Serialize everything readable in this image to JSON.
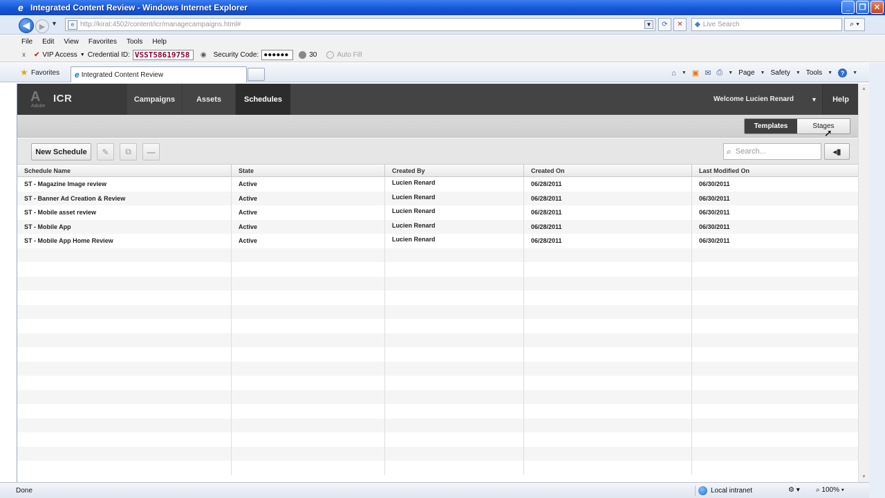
{
  "browser": {
    "window_title": "Integrated Content Review - Windows Internet Explorer",
    "address_url": "http://kirat:4502/content/icr/managecampaigns.html#",
    "search_placeholder": "Live Search",
    "menu": [
      "File",
      "Edit",
      "View",
      "Favorites",
      "Tools",
      "Help"
    ],
    "vip_toolbar": {
      "close_glyph": "x",
      "vip_label": "VIP Access",
      "credential_label": "Credential ID:",
      "credential_value": "VSST58619758",
      "security_label": "Security Code:",
      "security_value": "●●●●●●",
      "timer_value": "30",
      "autofill_label": "Auto Fill"
    },
    "favorites_label": "Favorites",
    "tab_title": "Integrated Content Review",
    "commands": {
      "page": "Page",
      "safety": "Safety",
      "tools": "Tools"
    },
    "status": {
      "left": "Done",
      "zone": "Local intranet",
      "zoom": "100%"
    }
  },
  "app": {
    "logo_word": "Adobe",
    "product": "ICR",
    "nav_tabs": [
      {
        "label": "Campaigns",
        "active": false
      },
      {
        "label": "Assets",
        "active": false
      },
      {
        "label": "Schedules",
        "active": true
      }
    ],
    "welcome": "Welcome Lucien Renard",
    "help": "Help",
    "segment": {
      "templates": "Templates",
      "stages": "Stages"
    },
    "new_schedule": "New Schedule",
    "search_placeholder": "Search...",
    "table": {
      "columns": [
        "Schedule Name",
        "State",
        "Created By",
        "Created On",
        "Last Modified On"
      ],
      "rows": [
        [
          "ST - Magazine Image review",
          "Active",
          "Lucien Renard",
          "06/28/2011",
          "06/30/2011"
        ],
        [
          "ST - Banner Ad Creation & Review",
          "Active",
          "Lucien Renard",
          "06/28/2011",
          "06/30/2011"
        ],
        [
          "ST - Mobile asset review",
          "Active",
          "Lucien Renard",
          "06/28/2011",
          "06/30/2011"
        ],
        [
          "ST - Mobile App",
          "Active",
          "Lucien Renard",
          "06/28/2011",
          "06/30/2011"
        ],
        [
          "ST - Mobile App Home Review",
          "Active",
          "Lucien Renard",
          "06/28/2011",
          "06/30/2011"
        ]
      ],
      "empty_row_count": 16
    }
  }
}
